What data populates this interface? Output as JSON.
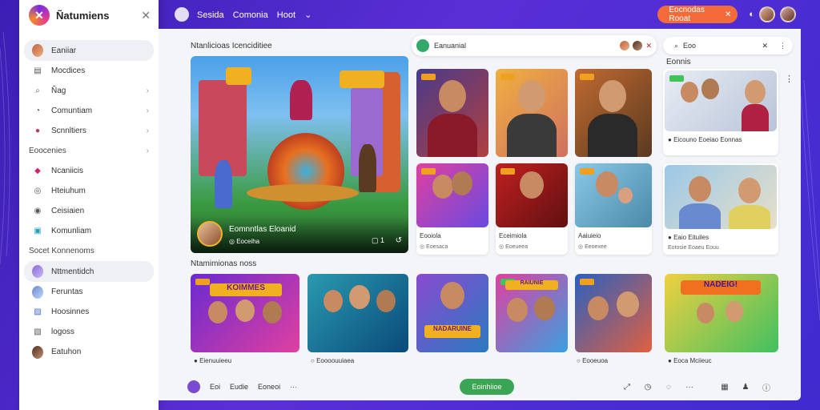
{
  "sidebar": {
    "brand": "Ñatumiens",
    "items": [
      {
        "label": "Eaniiar",
        "active": true
      },
      {
        "label": "Mocdices"
      },
      {
        "label": "Ñag"
      },
      {
        "label": "Comuntiam"
      },
      {
        "label": "Scnnltiers"
      }
    ],
    "section1": "Eoocenies",
    "items2": [
      {
        "label": "Ncaniicis"
      },
      {
        "label": "Hteiuhum"
      },
      {
        "label": "Ceisiaien"
      },
      {
        "label": "Komunliam"
      }
    ],
    "section2": "Socet Konnenoms",
    "items3": [
      {
        "label": "Nttmentidch",
        "active": true
      },
      {
        "label": "Feruntas"
      },
      {
        "label": "Hoosinnes"
      },
      {
        "label": "logoss"
      },
      {
        "label": "Eatuhon"
      }
    ]
  },
  "topbar": {
    "nav": [
      "Sesida",
      "Comonia",
      "Hoot"
    ],
    "cta": "Eocnodas Rooat"
  },
  "main": {
    "section1_title": "Ntanlicioas Icenciditiee",
    "chip_label": "Eanuanial",
    "search_placeholder": "Eoo",
    "right_col_title": "Eonnis",
    "featured": {
      "title": "Eomnntlas Eloanid",
      "sub": "Eoceiha",
      "count": "1"
    },
    "grid": [
      {
        "title": "Eooiola",
        "sub": "Eoesaca"
      },
      {
        "title": "Eceimiola",
        "sub": "Eoeueea"
      },
      {
        "title": "Aaiuieio",
        "sub": "Eeoexee"
      }
    ],
    "right_cards": [
      {
        "title": "Eicouno Eoeiao Eonnas"
      },
      {
        "title": "Eaio Eituiles",
        "sub": "Eotosie Eoaeu Eouu"
      }
    ],
    "section2_title": "Ntamimionas noss",
    "row2": [
      {
        "label": "Eienuuieeu"
      },
      {
        "label": "Eoooouuiaea"
      },
      {
        "label": "Eooeuoa"
      },
      {
        "label": "Eoca Mciieuc"
      }
    ],
    "row2_banners": [
      "KOIMMES",
      "NADARUINE",
      "RAIUNIE",
      "NADEIG!"
    ]
  },
  "bottombar": {
    "items": [
      "Eoi",
      "Eudie",
      "Eoneoi"
    ],
    "cta": "Eoinhiioe"
  },
  "colors": {
    "accent": "#f46b3a",
    "green": "#3aa552",
    "bg": "#4a2bd0"
  }
}
